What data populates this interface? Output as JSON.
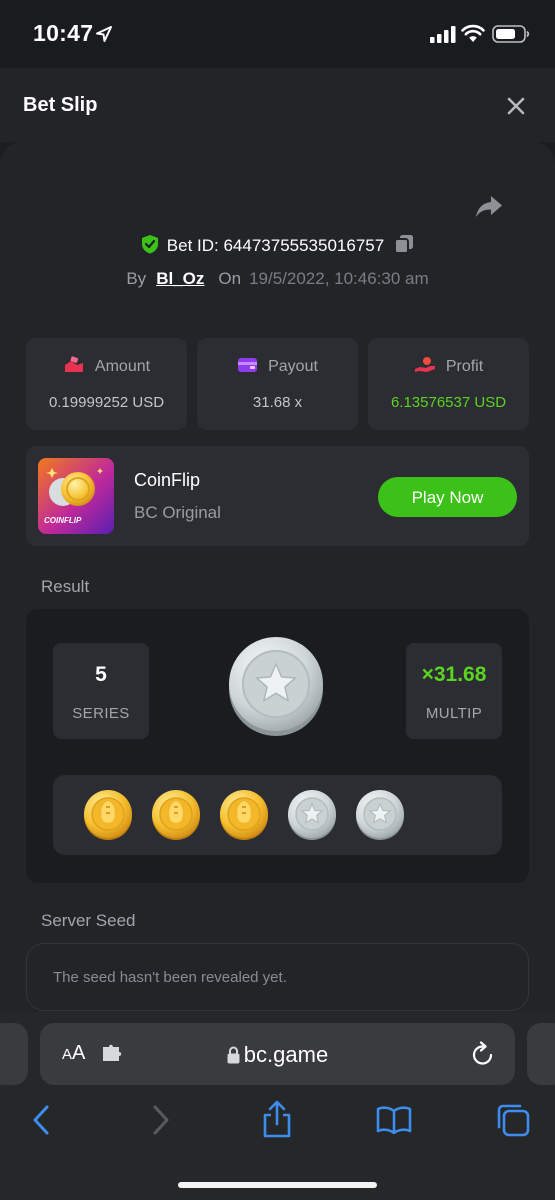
{
  "status_bar": {
    "time": "10:47"
  },
  "header": {
    "title": "Bet Slip"
  },
  "bet": {
    "id_label": "Bet ID: 64473755535016757",
    "by_label": "By",
    "username": "Bl_Oz",
    "on_label": "On",
    "date": "19/5/2022, 10:46:30 am"
  },
  "stats": {
    "amount_label": "Amount",
    "amount_value": "0.19999252 USD",
    "payout_label": "Payout",
    "payout_value": "31.68 x",
    "profit_label": "Profit",
    "profit_value": "6.13576537 USD"
  },
  "game": {
    "thumb_label": "COINFLIP",
    "name": "CoinFlip",
    "provider": "BC Original",
    "play_label": "Play Now"
  },
  "result": {
    "section_label": "Result",
    "series_value": "5",
    "series_label": "SERIES",
    "multiplier_value": "×31.68",
    "multiplier_label": "MULTIP",
    "main_coin": "silver",
    "coins": [
      "gold",
      "gold",
      "gold",
      "silver",
      "silver"
    ]
  },
  "seed": {
    "section_label": "Server Seed",
    "text": "The seed hasn't been revealed yet."
  },
  "browser": {
    "aa_large": "A",
    "aa_small": "A",
    "url": "bc.game"
  },
  "colors": {
    "accent_green": "#3bc117",
    "profit_green": "#5ad322",
    "background": "#232428",
    "card": "#2c2d32"
  }
}
